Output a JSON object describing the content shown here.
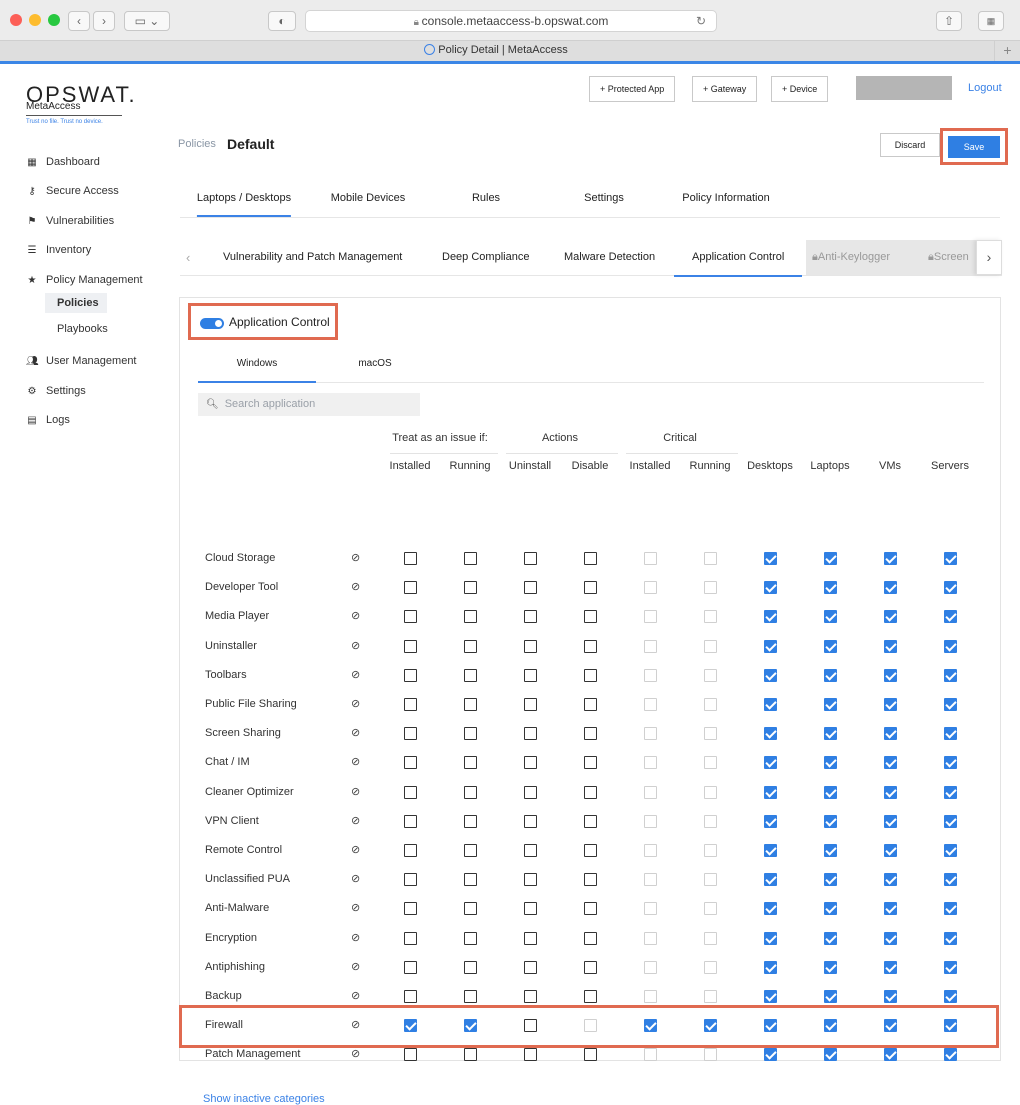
{
  "browser": {
    "url": "console.metaaccess-b.opswat.com",
    "tab_title": "Policy Detail | MetaAccess"
  },
  "brand": {
    "logo": "OPSWAT.",
    "product": "MetaAccess",
    "tagline": "Trust no file. Trust no device."
  },
  "nav": {
    "dashboard": "Dashboard",
    "secure_access": "Secure Access",
    "vulnerabilities": "Vulnerabilities",
    "inventory": "Inventory",
    "policy_management": "Policy Management",
    "policies": "Policies",
    "playbooks": "Playbooks",
    "user_management": "User Management",
    "settings": "Settings",
    "logs": "Logs"
  },
  "topbar": {
    "protected_app": "+ Protected App",
    "gateway": "+ Gateway",
    "device": "+ Device",
    "logout": "Logout"
  },
  "header": {
    "breadcrumb": "Policies",
    "title": "Default",
    "discard": "Discard",
    "save": "Save"
  },
  "tabs": [
    "Laptops / Desktops",
    "Mobile Devices",
    "Rules",
    "Settings",
    "Policy Information"
  ],
  "subtabs": [
    "Vulnerability and Patch Management",
    "Deep Compliance",
    "Malware Detection",
    "Application Control"
  ],
  "locked_tabs": [
    "Anti-Keylogger",
    "Screen"
  ],
  "app_control": {
    "label": "Application Control",
    "os_tabs": [
      "Windows",
      "macOS"
    ],
    "search_placeholder": "Search application",
    "groups": [
      "Treat as an issue if:",
      "Actions",
      "Critical"
    ],
    "columns": [
      "Installed",
      "Running",
      "Uninstall",
      "Disable",
      "Installed",
      "Running",
      "Desktops",
      "Laptops",
      "VMs",
      "Servers"
    ],
    "show_inactive": "Show inactive categories"
  },
  "rows": [
    {
      "name": "Cloud Storage",
      "checked": [
        0,
        0,
        0,
        0,
        0,
        0,
        1,
        1,
        1,
        1
      ]
    },
    {
      "name": "Developer Tool",
      "checked": [
        0,
        0,
        0,
        0,
        0,
        0,
        1,
        1,
        1,
        1
      ]
    },
    {
      "name": "Media Player",
      "checked": [
        0,
        0,
        0,
        0,
        0,
        0,
        1,
        1,
        1,
        1
      ]
    },
    {
      "name": "Uninstaller",
      "checked": [
        0,
        0,
        0,
        0,
        0,
        0,
        1,
        1,
        1,
        1
      ]
    },
    {
      "name": "Toolbars",
      "checked": [
        0,
        0,
        0,
        0,
        0,
        0,
        1,
        1,
        1,
        1
      ]
    },
    {
      "name": "Public File Sharing",
      "checked": [
        0,
        0,
        0,
        0,
        0,
        0,
        1,
        1,
        1,
        1
      ]
    },
    {
      "name": "Screen Sharing",
      "checked": [
        0,
        0,
        0,
        0,
        0,
        0,
        1,
        1,
        1,
        1
      ]
    },
    {
      "name": "Chat / IM",
      "checked": [
        0,
        0,
        0,
        0,
        0,
        0,
        1,
        1,
        1,
        1
      ]
    },
    {
      "name": "Cleaner Optimizer",
      "checked": [
        0,
        0,
        0,
        0,
        0,
        0,
        1,
        1,
        1,
        1
      ]
    },
    {
      "name": "VPN Client",
      "checked": [
        0,
        0,
        0,
        0,
        0,
        0,
        1,
        1,
        1,
        1
      ]
    },
    {
      "name": "Remote Control",
      "checked": [
        0,
        0,
        0,
        0,
        0,
        0,
        1,
        1,
        1,
        1
      ]
    },
    {
      "name": "Unclassified PUA",
      "checked": [
        0,
        0,
        0,
        0,
        0,
        0,
        1,
        1,
        1,
        1
      ]
    },
    {
      "name": "Anti-Malware",
      "checked": [
        0,
        0,
        0,
        0,
        0,
        0,
        1,
        1,
        1,
        1
      ]
    },
    {
      "name": "Encryption",
      "checked": [
        0,
        0,
        0,
        0,
        0,
        0,
        1,
        1,
        1,
        1
      ]
    },
    {
      "name": "Antiphishing",
      "checked": [
        0,
        0,
        0,
        0,
        0,
        0,
        1,
        1,
        1,
        1
      ]
    },
    {
      "name": "Backup",
      "checked": [
        0,
        0,
        0,
        0,
        0,
        0,
        1,
        1,
        1,
        1
      ]
    },
    {
      "name": "Firewall",
      "checked": [
        1,
        1,
        0,
        0,
        1,
        1,
        1,
        1,
        1,
        1
      ]
    },
    {
      "name": "Patch Management",
      "checked": [
        0,
        0,
        0,
        0,
        0,
        0,
        1,
        1,
        1,
        1
      ]
    }
  ]
}
